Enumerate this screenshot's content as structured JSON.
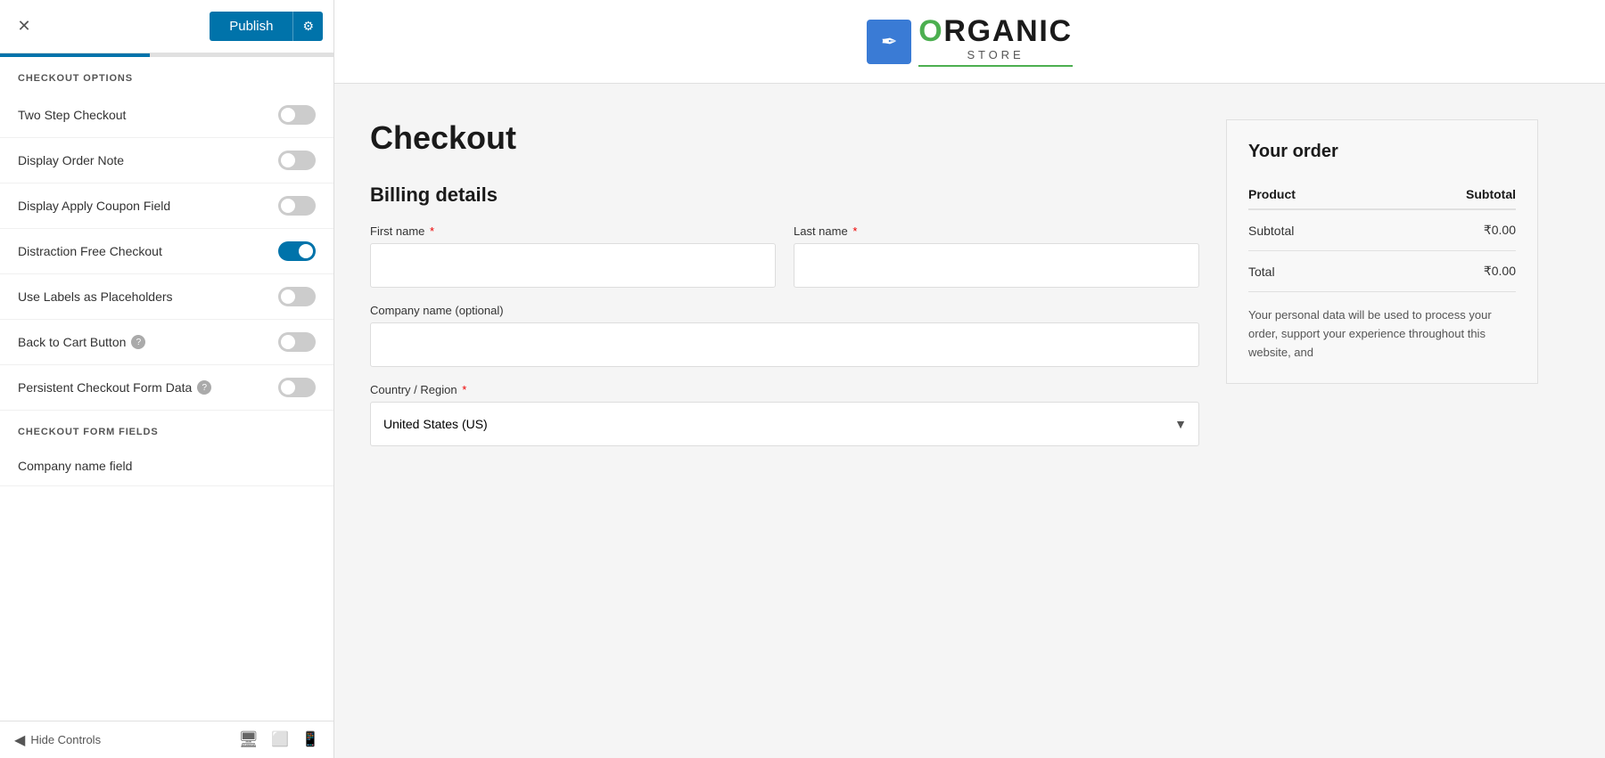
{
  "topbar": {
    "close_label": "✕",
    "publish_label": "Publish",
    "gear_label": "⚙"
  },
  "sidebar": {
    "checkout_options_header": "CHECKOUT OPTIONS",
    "checkout_form_fields_header": "CHECKOUT FORM FIELDS",
    "toggles": [
      {
        "id": "two-step",
        "label": "Two Step Checkout",
        "checked": false,
        "has_help": false
      },
      {
        "id": "display-order-note",
        "label": "Display Order Note",
        "checked": false,
        "has_help": false
      },
      {
        "id": "display-apply-coupon",
        "label": "Display Apply Coupon Field",
        "checked": false,
        "has_help": false
      },
      {
        "id": "distraction-free",
        "label": "Distraction Free Checkout",
        "checked": true,
        "has_help": false
      },
      {
        "id": "use-labels",
        "label": "Use Labels as Placeholders",
        "checked": false,
        "has_help": false
      },
      {
        "id": "back-to-cart",
        "label": "Back to Cart Button",
        "checked": false,
        "has_help": true
      },
      {
        "id": "persistent-checkout",
        "label": "Persistent Checkout Form Data",
        "checked": false,
        "has_help": true
      }
    ],
    "form_fields": [
      {
        "label": "Company name field"
      }
    ],
    "hide_controls_label": "Hide Controls"
  },
  "header": {
    "logo_icon": "✒",
    "logo_text_main": "ORGANIC",
    "logo_text_accent": "STORE"
  },
  "checkout": {
    "page_title": "Checkout",
    "billing_title": "Billing details",
    "fields": {
      "first_name_label": "First name",
      "last_name_label": "Last name",
      "company_label": "Company name (optional)",
      "country_label": "Country / Region",
      "country_value": "United States (US)"
    },
    "order_summary": {
      "title": "Your order",
      "col_product": "Product",
      "col_subtotal": "Subtotal",
      "row_subtotal_label": "Subtotal",
      "row_subtotal_value": "₹0.00",
      "row_total_label": "Total",
      "row_total_value": "₹0.00",
      "privacy_text": "Your personal data will be used to process your order, support your experience throughout this website, and"
    }
  },
  "devices": {
    "desktop_icon": "🖥",
    "tablet_icon": "📱",
    "mobile_icon": "📱"
  }
}
